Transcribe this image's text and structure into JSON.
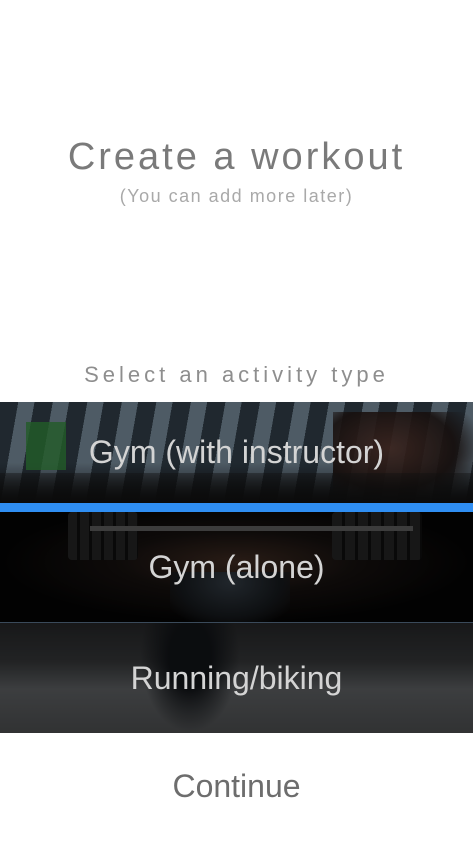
{
  "header": {
    "title": "Create a workout",
    "subtitle": "(You can add more later)"
  },
  "activity": {
    "section_label": "Select an activity type",
    "selected_index": 0,
    "accent_color": "#2f8ef2",
    "options": [
      {
        "label": "Gym (with instructor)",
        "image": "gym-class-photo"
      },
      {
        "label": "Gym (alone)",
        "image": "weightlifting-photo"
      },
      {
        "label": "Running/biking",
        "image": "running-photo"
      }
    ]
  },
  "footer": {
    "continue_label": "Continue"
  }
}
